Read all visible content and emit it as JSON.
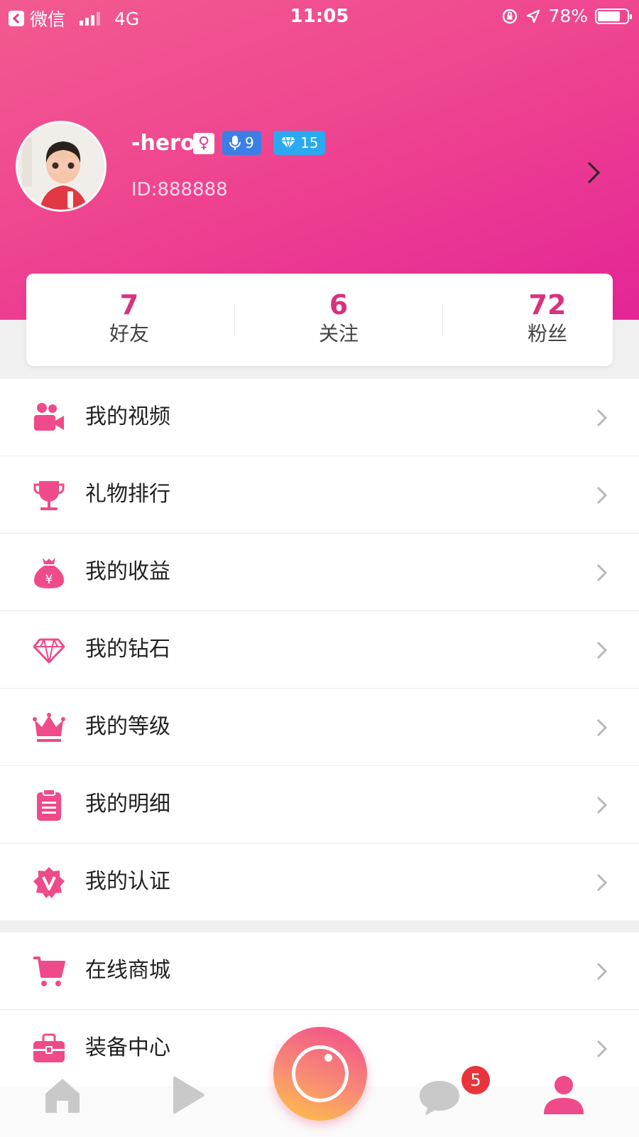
{
  "status_bar": {
    "back_app": "微信",
    "network": "4G",
    "time": "11:05",
    "battery": "78%",
    "battery_level": 0.78
  },
  "profile": {
    "username": "-hero",
    "gender_symbol": "♀",
    "mic_level": "9",
    "diamond_level": "15",
    "user_id": "ID:888888"
  },
  "stats": [
    {
      "value": "7",
      "label": "好友"
    },
    {
      "value": "6",
      "label": "关注"
    },
    {
      "value": "72",
      "label": "粉丝"
    }
  ],
  "menu_group_1": [
    {
      "label": "我的视频",
      "icon": "video-camera-icon"
    },
    {
      "label": "礼物排行",
      "icon": "trophy-icon"
    },
    {
      "label": "我的收益",
      "icon": "money-bag-icon"
    },
    {
      "label": "我的钻石",
      "icon": "diamond-icon"
    },
    {
      "label": "我的等级",
      "icon": "crown-icon"
    },
    {
      "label": "我的明细",
      "icon": "clipboard-icon"
    },
    {
      "label": "我的认证",
      "icon": "verified-badge-icon"
    }
  ],
  "menu_group_2": [
    {
      "label": "在线商城",
      "icon": "shopping-cart-icon"
    },
    {
      "label": "装备中心",
      "icon": "briefcase-icon"
    }
  ],
  "bottom_nav": {
    "message_count": "5"
  },
  "colors": {
    "accent": "#e8378f",
    "header_start": "#f25a8f",
    "header_end": "#e42596"
  }
}
